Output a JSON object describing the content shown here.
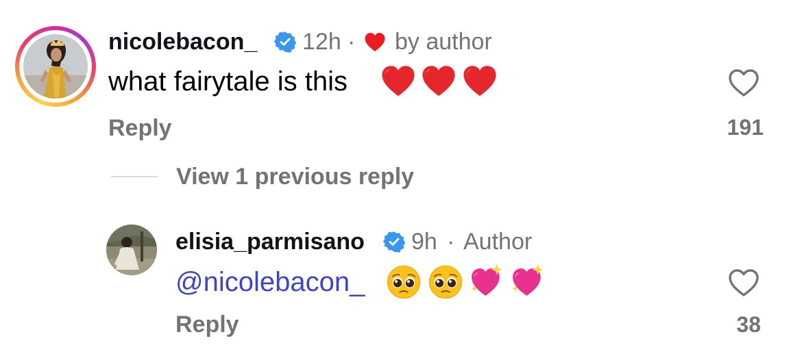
{
  "comment": {
    "username": "nicolebacon_",
    "time": "12h",
    "separator": "·",
    "liked_by": "by author",
    "text": "what fairytale is this",
    "emojis": [
      "red-heart",
      "red-heart",
      "red-heart"
    ],
    "reply_label": "Reply",
    "like_count": "191"
  },
  "view_replies": {
    "label": "View 1 previous reply"
  },
  "reply": {
    "username": "elisia_parmisano",
    "time": "9h",
    "separator": "·",
    "badge": "Author",
    "mention": "@nicolebacon_",
    "emojis": [
      "pleading-face",
      "pleading-face",
      "sparkling-heart",
      "sparkling-heart"
    ],
    "reply_label": "Reply",
    "like_count": "38"
  },
  "colors": {
    "meta_gray": "#737373",
    "verified_blue": "#3897f0",
    "mention_blue": "#3d45c4",
    "heart_red": "#ed1c24"
  }
}
